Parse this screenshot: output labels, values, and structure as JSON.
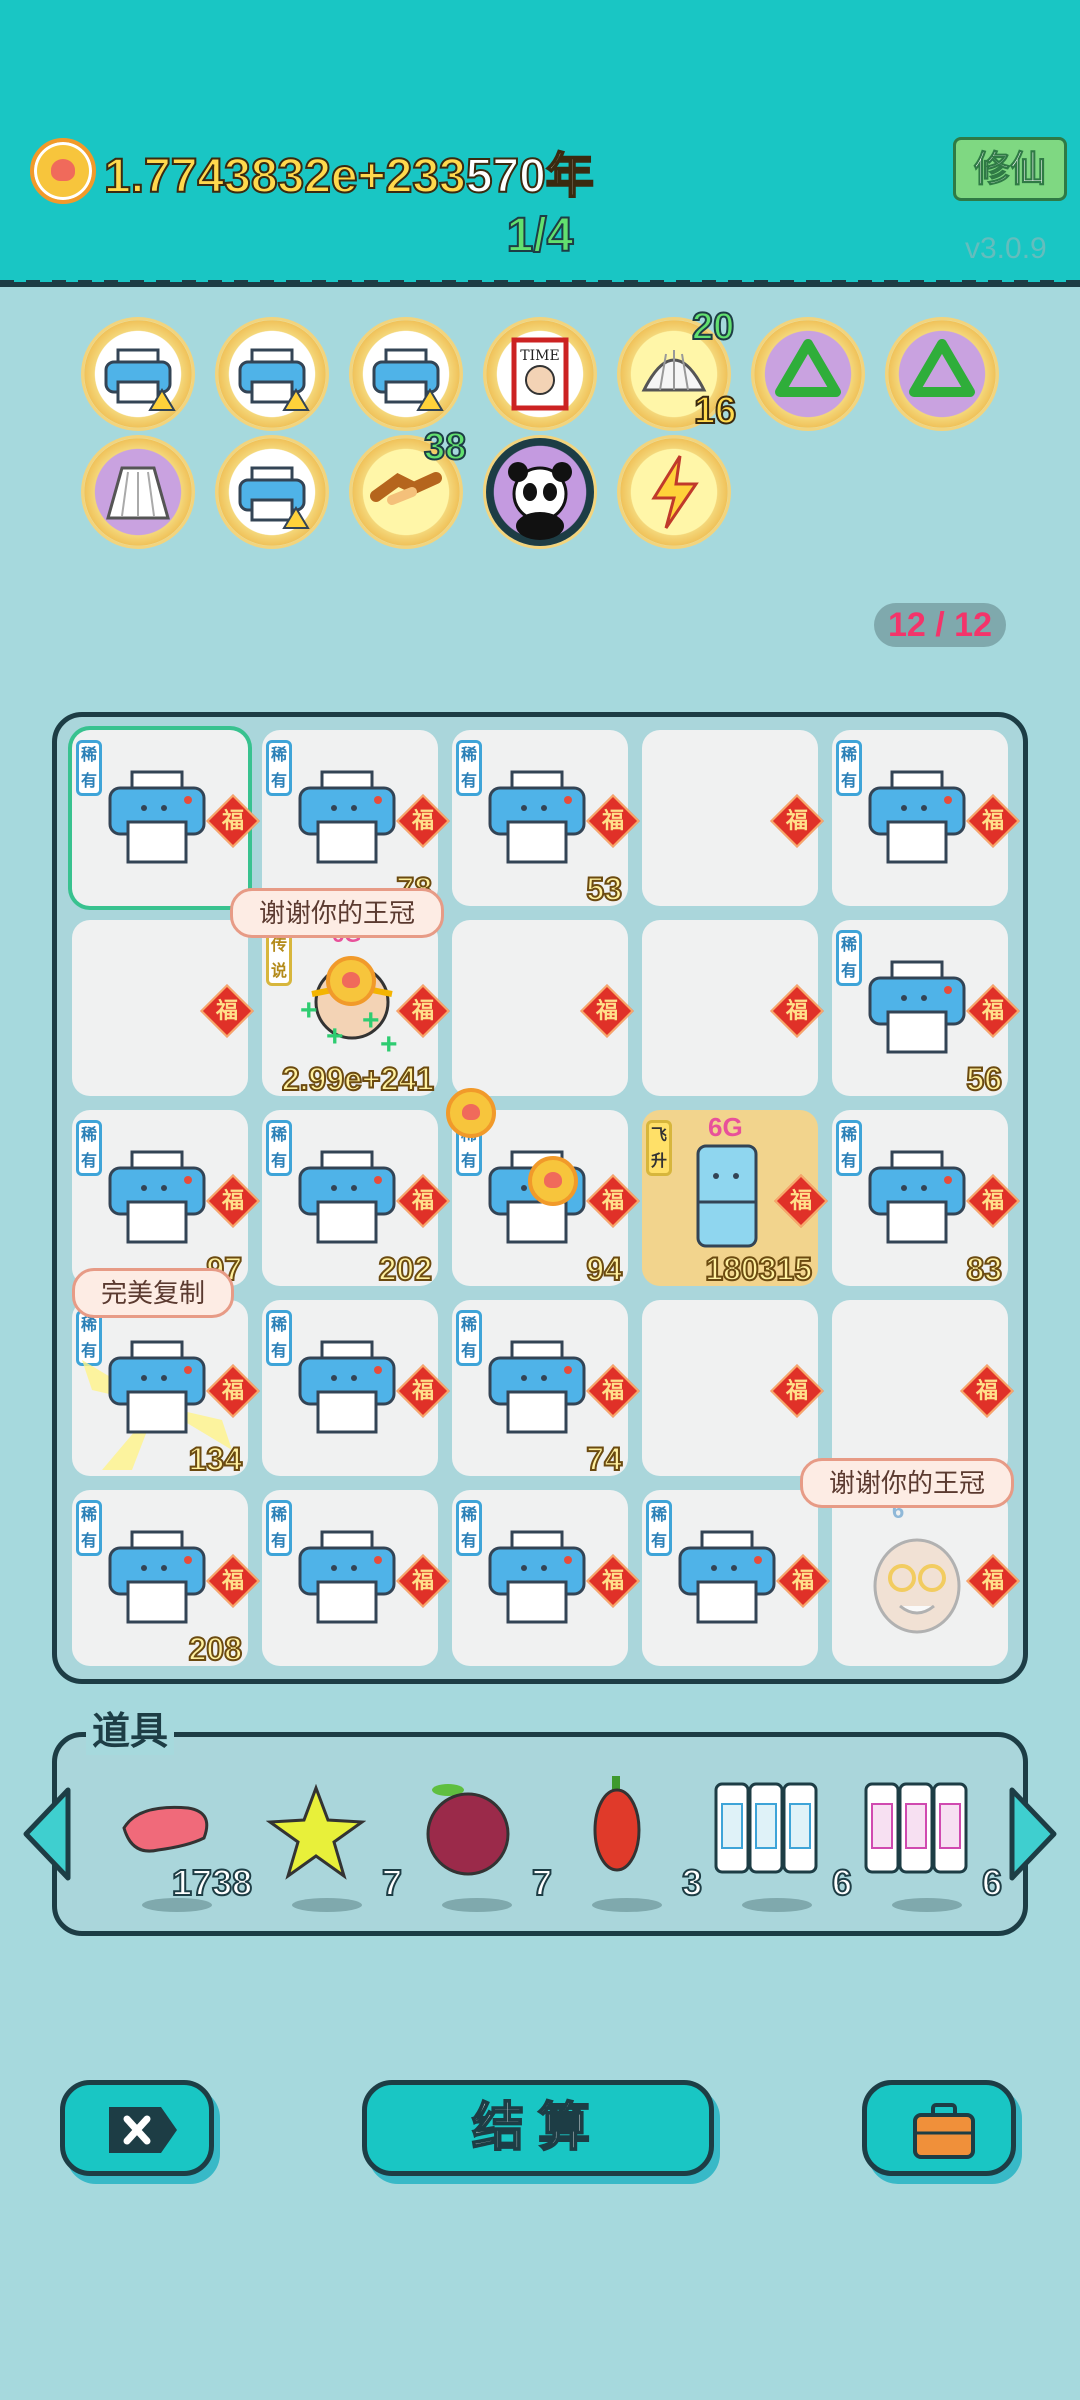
{
  "header": {
    "money": "1.7743832e+233",
    "years": "570年",
    "level": "1/4",
    "xiuxian_label": "修仙",
    "version": "v3.0.9"
  },
  "buffs": [
    {
      "icon": "printer-warning-icon"
    },
    {
      "icon": "printer-warning-icon"
    },
    {
      "icon": "printer-warning-icon"
    },
    {
      "icon": "time-magazine-icon"
    },
    {
      "icon": "shell-icon",
      "count_top": "20",
      "count_bottom": "16"
    },
    {
      "icon": "recycle-icon"
    },
    {
      "icon": "recycle-icon"
    },
    {
      "icon": "skirt-icon"
    },
    {
      "icon": "printer-warning-icon"
    },
    {
      "icon": "handshake-icon",
      "count_top": "38"
    },
    {
      "icon": "panda-icon"
    },
    {
      "icon": "lightning-icon"
    }
  ],
  "slots": "12 / 12",
  "board": {
    "rare_label": "稀有",
    "legend_label": "传说",
    "fly_label": "飞升",
    "fu_label": "福",
    "bubble_crown_1": "谢谢你的王冠",
    "bubble_copy": "完美复制",
    "bubble_crown_2": "谢谢你的王冠",
    "counts": {
      "r1c2": "78",
      "r1c3": "53",
      "r2c2": "2.99e+241",
      "r2c5": "56",
      "r3c1": "97",
      "r3c2": "202",
      "r3c3": "94",
      "r3c4": "180315",
      "r3c5": "83",
      "r4c1": "134",
      "r4c3": "74",
      "r5c1": "208"
    },
    "fridge_badge": "6G",
    "legend_badge": "6G",
    "crown_badge": "6"
  },
  "props": {
    "title": "道具",
    "items": [
      {
        "icon": "liver-icon",
        "count": "1738"
      },
      {
        "icon": "star-icon",
        "count": "7"
      },
      {
        "icon": "bayberry-icon",
        "count": "7"
      },
      {
        "icon": "chili-icon",
        "count": "3"
      },
      {
        "icon": "rare-cards-icon",
        "count": "6"
      },
      {
        "icon": "legend-cards-icon",
        "count": "6"
      }
    ]
  },
  "buttons": {
    "settle": "结算"
  },
  "colors": {
    "header_bg": "#19c6c4",
    "page_bg": "#a6d9dd",
    "gold_text": "#ffd94d",
    "green_text": "#62e06f",
    "slots_text": "#f4346a"
  }
}
